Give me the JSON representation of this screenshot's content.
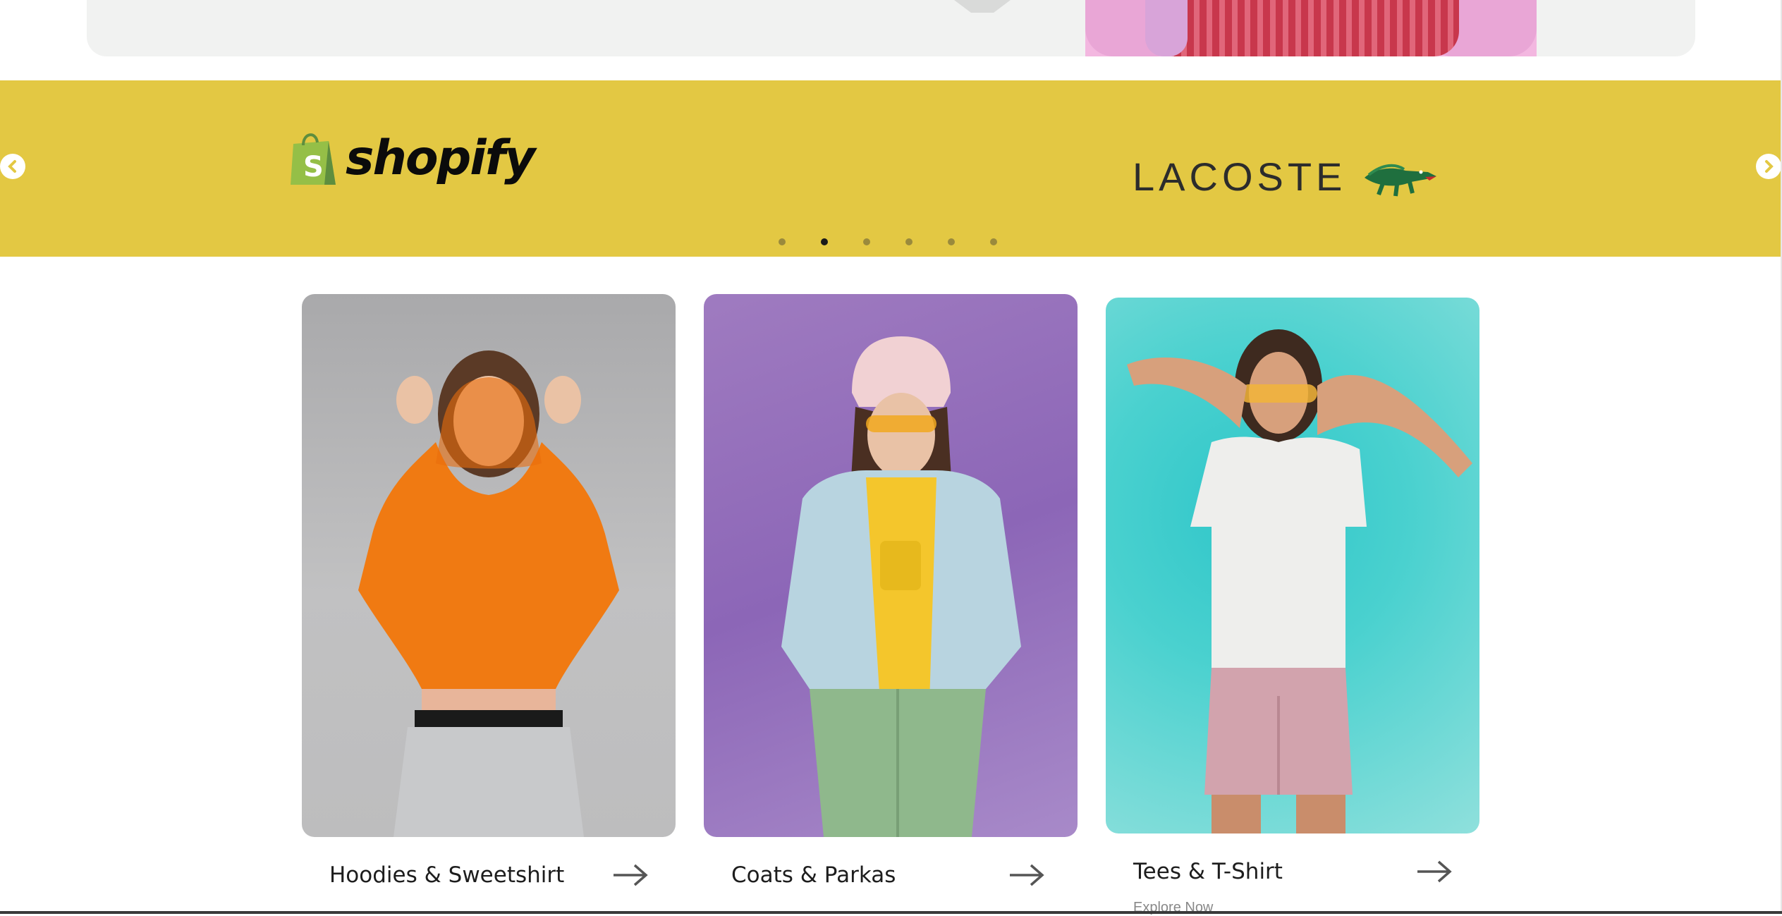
{
  "brands": {
    "items": [
      {
        "name": "shopify"
      },
      {
        "name": "LACOSTE"
      }
    ],
    "prev_icon": "chevron-left-icon",
    "next_icon": "chevron-right-icon",
    "dots": {
      "count": 6,
      "active_index": 1
    }
  },
  "categories": [
    {
      "label": "Hoodies & Sweetshirt",
      "arrow_icon": "arrow-right-icon",
      "background": "#b4b4b6"
    },
    {
      "label": "Coats & Parkas",
      "arrow_icon": "arrow-right-icon",
      "background": "#9a77bd"
    },
    {
      "label": "Tees & T-Shirt",
      "sublabel": "Explore Now",
      "arrow_icon": "arrow-right-icon",
      "background": "#45cfcd"
    }
  ],
  "colors": {
    "brand_band": "#e3c843",
    "hero_bg": "#f1f2f1",
    "active_dot": "#1a1a1a",
    "inactive_dot": "#9a8a3c"
  }
}
